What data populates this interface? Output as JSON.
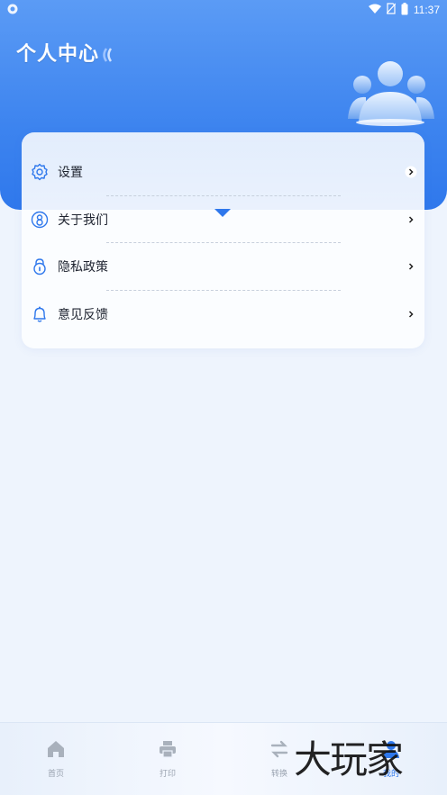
{
  "status_bar": {
    "time": "11:37",
    "battery_level": "80"
  },
  "header": {
    "title": "个人中心"
  },
  "menu": [
    {
      "label": "设置",
      "icon": "gear-icon"
    },
    {
      "label": "关于我们",
      "icon": "person-circle-icon"
    },
    {
      "label": "隐私政策",
      "icon": "lock-icon"
    },
    {
      "label": "意见反馈",
      "icon": "bell-icon"
    }
  ],
  "bottom_nav": {
    "items": [
      {
        "label": "首页",
        "icon": "home-icon",
        "active": false
      },
      {
        "label": "打印",
        "icon": "printer-icon",
        "active": false
      },
      {
        "label": "转换",
        "icon": "swap-icon",
        "active": false
      },
      {
        "label": "我的",
        "icon": "profile-icon",
        "active": true
      }
    ]
  },
  "watermark": "大玩家",
  "colors": {
    "accent": "#2f78ec",
    "header_top": "#5b9bf5",
    "background": "#eef4fd"
  }
}
